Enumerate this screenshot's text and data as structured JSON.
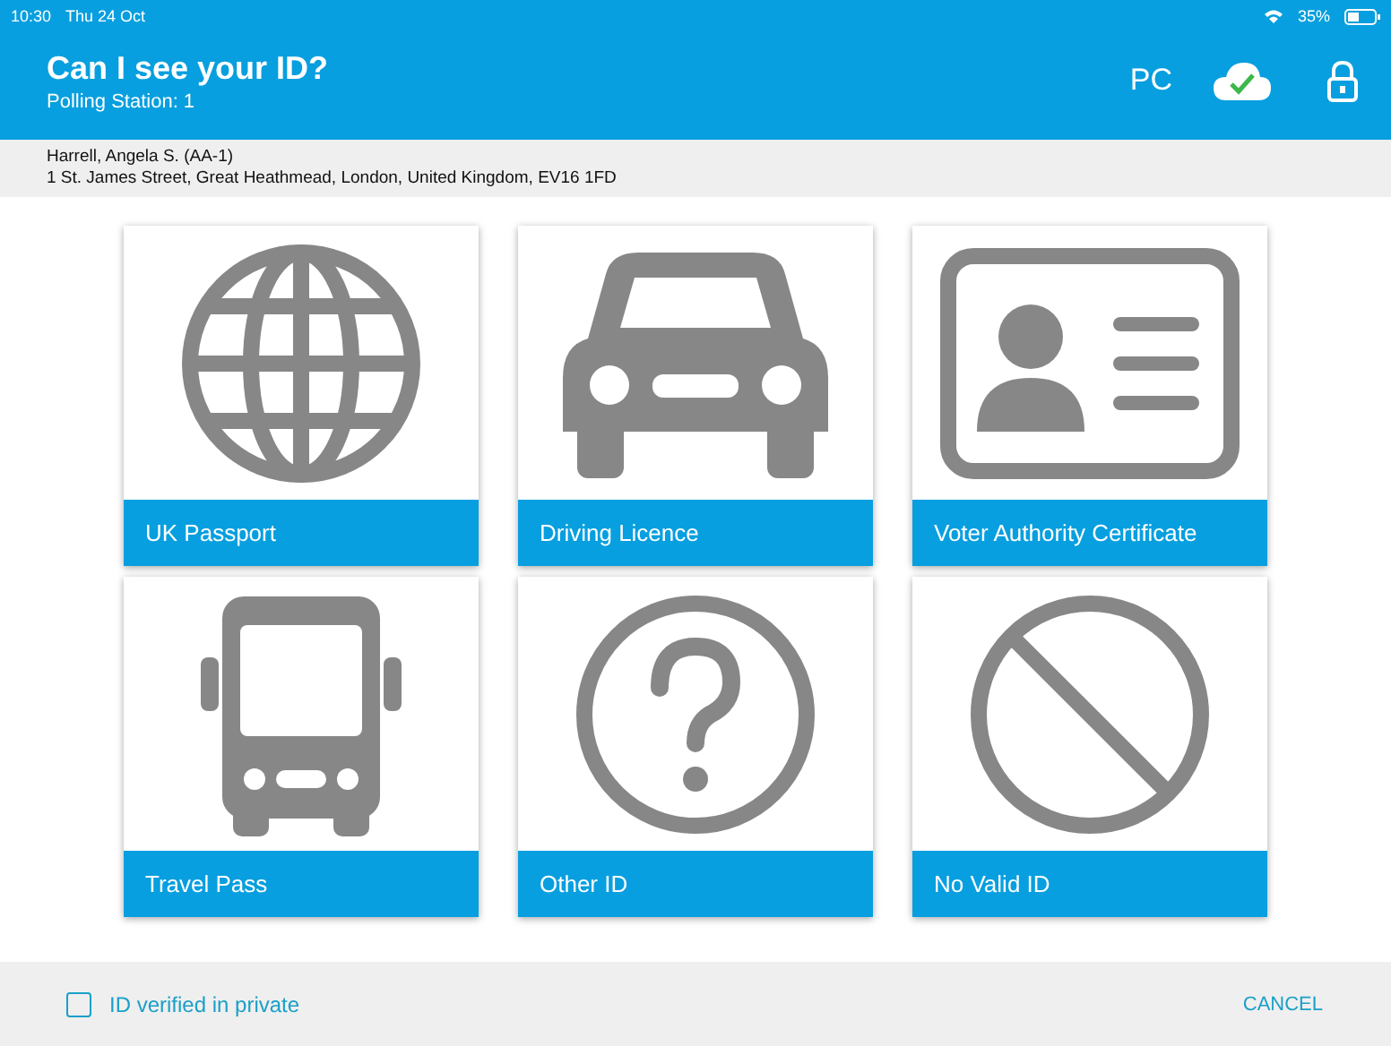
{
  "status_bar": {
    "time": "10:30",
    "date": "Thu 24 Oct",
    "battery": "35%"
  },
  "header": {
    "title": "Can I see your ID?",
    "subtitle": "Polling Station: 1",
    "user": "PC"
  },
  "voter": {
    "name": "Harrell, Angela S. (AA-1)",
    "address": "1 St. James Street, Great Heathmead, London, United Kingdom, EV16 1FD"
  },
  "options": [
    {
      "kind": "globe",
      "label": "UK Passport"
    },
    {
      "kind": "car",
      "label": "Driving Licence"
    },
    {
      "kind": "idcard",
      "label": "Voter Authority Certificate"
    },
    {
      "kind": "bus",
      "label": "Travel Pass"
    },
    {
      "kind": "question",
      "label": "Other ID"
    },
    {
      "kind": "none",
      "label": "No Valid ID"
    }
  ],
  "footer": {
    "checkbox": {
      "label": "ID verified in private",
      "checked": false
    },
    "cancel": "CANCEL"
  }
}
